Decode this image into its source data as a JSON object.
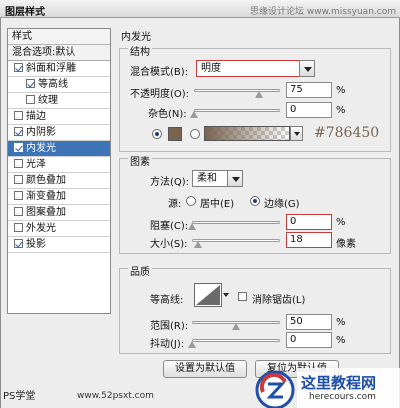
{
  "window": {
    "title": "图层样式",
    "watermark_top": "思缘设计论坛 www.missyuan.com"
  },
  "styles_panel": {
    "title": "样式",
    "blend_options": "混合选项:默认",
    "items": [
      {
        "label": "斜面和浮雕",
        "checked": true,
        "indent": false,
        "selected": false
      },
      {
        "label": "等高线",
        "checked": true,
        "indent": true,
        "selected": false
      },
      {
        "label": "纹理",
        "checked": false,
        "indent": true,
        "selected": false
      },
      {
        "label": "描边",
        "checked": false,
        "indent": false,
        "selected": false
      },
      {
        "label": "内阴影",
        "checked": true,
        "indent": false,
        "selected": false
      },
      {
        "label": "内发光",
        "checked": true,
        "indent": false,
        "selected": true
      },
      {
        "label": "光泽",
        "checked": false,
        "indent": false,
        "selected": false
      },
      {
        "label": "颜色叠加",
        "checked": false,
        "indent": false,
        "selected": false
      },
      {
        "label": "渐变叠加",
        "checked": false,
        "indent": false,
        "selected": false
      },
      {
        "label": "图案叠加",
        "checked": false,
        "indent": false,
        "selected": false
      },
      {
        "label": "外发光",
        "checked": false,
        "indent": false,
        "selected": false
      },
      {
        "label": "投影",
        "checked": true,
        "indent": false,
        "selected": false
      }
    ]
  },
  "inner_glow": {
    "title": "内发光",
    "structure": {
      "legend": "结构",
      "blend_mode_label": "混合模式(B):",
      "blend_mode_value": "明度",
      "opacity_label": "不透明度(O):",
      "opacity_value": "75",
      "opacity_unit": "%",
      "opacity_level": 0.75,
      "noise_label": "杂色(N):",
      "noise_value": "0",
      "noise_unit": "%",
      "noise_level": 0,
      "color_hex": "#786450",
      "color_text": "#786450"
    },
    "elements": {
      "legend": "图素",
      "method_label": "方法(Q):",
      "method_value": "柔和",
      "source_label": "源:",
      "source_center": "居中(E)",
      "source_edge": "边缘(G)",
      "choke_label": "阻塞(C):",
      "choke_value": "0",
      "choke_unit": "%",
      "choke_level": 0,
      "size_label": "大小(S):",
      "size_value": "18",
      "size_unit": "像素",
      "size_level": 0.07
    },
    "quality": {
      "legend": "品质",
      "contour_label": "等高线:",
      "antialias_label": "消除锯齿(L)",
      "range_label": "范围(R):",
      "range_value": "50",
      "range_unit": "%",
      "range_level": 0.5,
      "jitter_label": "抖动(J):",
      "jitter_value": "0",
      "jitter_unit": "%",
      "jitter_level": 0
    },
    "buttons": {
      "set_default": "设置为默认值",
      "reset_default": "复位为默认值"
    }
  },
  "watermarks": {
    "ps_tag": "PS学堂",
    "site": "www.52psxt.com",
    "brand_cn": "这里教程网",
    "brand_en": "herecours.com"
  },
  "colors": {
    "selected": "#3d74b8",
    "highlight_border": "#c93a3a",
    "brand_blue": "#1f4fa8"
  }
}
